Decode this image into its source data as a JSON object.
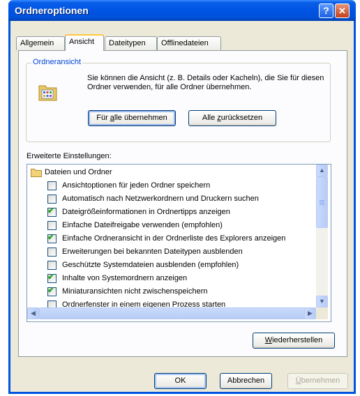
{
  "window": {
    "title": "Ordneroptionen",
    "help_label": "?",
    "close_label": "✕"
  },
  "tabs": [
    {
      "label": "Allgemein"
    },
    {
      "label": "Ansicht",
      "active": true
    },
    {
      "label": "Dateitypen"
    },
    {
      "label": "Offlinedateien"
    }
  ],
  "folder_view": {
    "group_title": "Ordneransicht",
    "description": "Sie können die Ansicht (z. B. Details oder Kacheln), die Sie für diesen Ordner verwenden, für alle Ordner übernehmen.",
    "apply_all": {
      "pre": "Für ",
      "accel": "a",
      "post": "lle übernehmen"
    },
    "reset_all": {
      "pre": "Alle ",
      "accel": "z",
      "post": "urücksetzen"
    }
  },
  "advanced": {
    "label": "Erweiterte Einstellungen:",
    "folder_label": "Dateien und Ordner",
    "items": [
      {
        "label": "Ansichtoptionen für jeden Ordner speichern",
        "checked": false
      },
      {
        "label": "Automatisch nach Netzwerkordnern und Druckern suchen",
        "checked": false
      },
      {
        "label": "Dateigrößeinformationen in Ordnertipps anzeigen",
        "checked": true
      },
      {
        "label": "Einfache Dateifreigabe verwenden (empfohlen)",
        "checked": false
      },
      {
        "label": "Einfache Ordneransicht in der Ordnerliste des Explorers anzeigen",
        "checked": true
      },
      {
        "label": "Erweiterungen bei bekannten Dateitypen ausblenden",
        "checked": false
      },
      {
        "label": "Geschützte Systemdateien ausblenden (empfohlen)",
        "checked": false
      },
      {
        "label": "Inhalte von Systemordnern anzeigen",
        "checked": true
      },
      {
        "label": "Miniaturansichten nicht zwischenspeichern",
        "checked": true
      },
      {
        "label": "Ordnerfenster in einem eigenen Prozess starten",
        "checked": false
      }
    ],
    "restore": {
      "accel": "W",
      "post": "iederherstellen"
    }
  },
  "footer": {
    "ok_label": "OK",
    "cancel_label": "Abbrechen",
    "apply": {
      "accel": "Ü",
      "post": "bernehmen"
    }
  },
  "colors": {
    "titlebar": "#0054e3",
    "client": "#ece9d8",
    "group_title": "#0046d5",
    "checkmark": "#21a121"
  }
}
